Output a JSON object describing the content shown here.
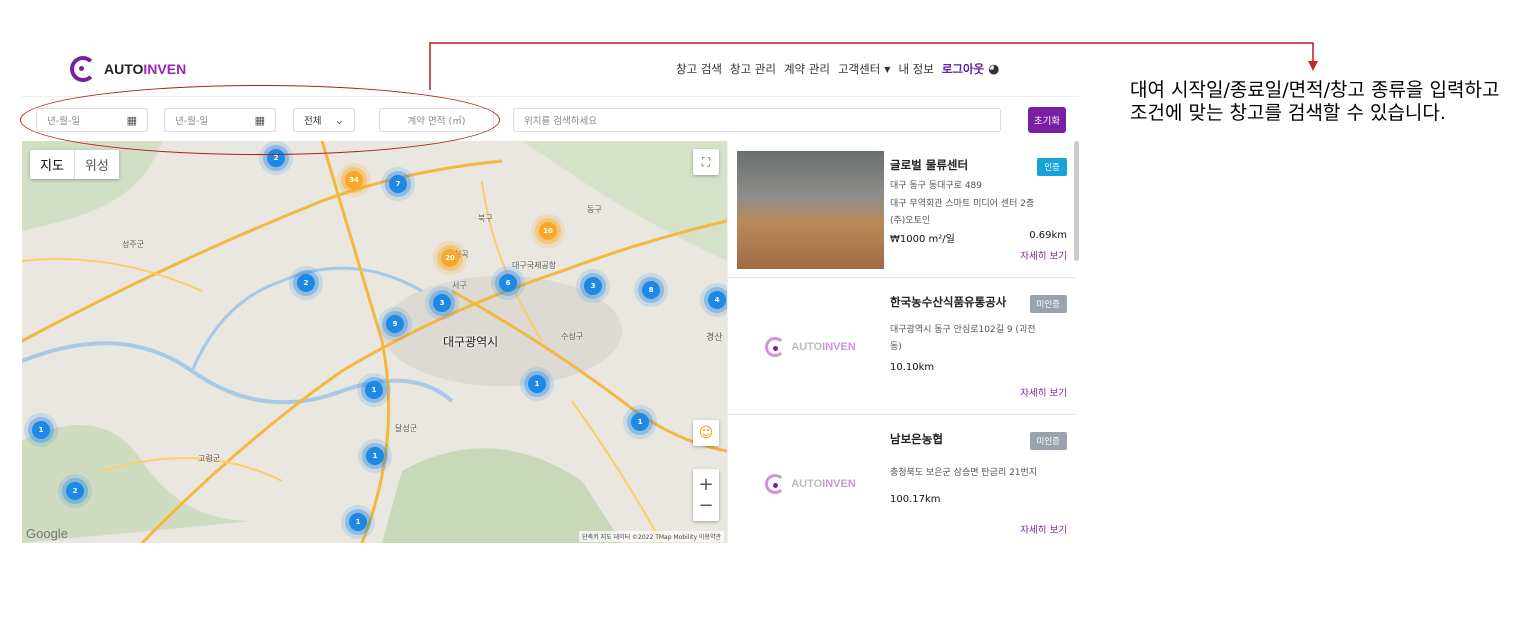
{
  "logo": {
    "text_a": "AUTO",
    "text_b": "INVEN"
  },
  "nav": {
    "items": [
      "창고 검색",
      "창고 관리",
      "계약 관리",
      "고객센터"
    ],
    "my_info": "내 정보",
    "logout": "로그아웃"
  },
  "filters": {
    "start_date": "년-월-일",
    "end_date": "년-월-일",
    "type_select": "전체",
    "area_placeholder": "계약 면적 (㎡)",
    "location_placeholder": "위치를 검색하세요",
    "reset": "초기화"
  },
  "map": {
    "types": [
      "지도",
      "위성"
    ],
    "city_label": "대구광역시",
    "places": [
      "성주군",
      "북구",
      "칠곡",
      "동구",
      "대구국제공항",
      "서구",
      "수성구",
      "경산",
      "달성군",
      "고령군"
    ],
    "clusters": [
      "2",
      "34",
      "7",
      "10",
      "20",
      "6",
      "3",
      "8",
      "4",
      "2",
      "3",
      "9",
      "1",
      "1",
      "1",
      "1",
      "1",
      "2",
      "1"
    ],
    "google": "Google",
    "attribution": "단축키   지도 데이터 ©2022 TMap Mobility   이용약관"
  },
  "listings": [
    {
      "title": "글로벌 물류센터",
      "badge": "인증",
      "address1": "대구 동구 동대구로 489",
      "address2": "대구 무역회관 스마트 미디어 센터 2층",
      "company": "(주)오토인",
      "price": "₩1000 m²/일",
      "distance": "0.69km",
      "more": "자세히 보기"
    },
    {
      "title": "한국농수산식품유통공사",
      "badge": "미인증",
      "address1": "대구광역시 동구 안심로102길 9 (괴전",
      "address2": "동)",
      "distance": "10.10km",
      "more": "자세히 보기"
    },
    {
      "title": "남보은농협",
      "badge": "미인증",
      "address1": "충청북도 보은군 삼승면 탄금리 21번지",
      "distance": "100.17km",
      "more": "자세히 보기"
    }
  ],
  "annotation": {
    "text": "대여 시작일/종료일/면적/창고 종류을 입력하고 조건에 맞는 창고를 검색할 수 있습니다."
  }
}
